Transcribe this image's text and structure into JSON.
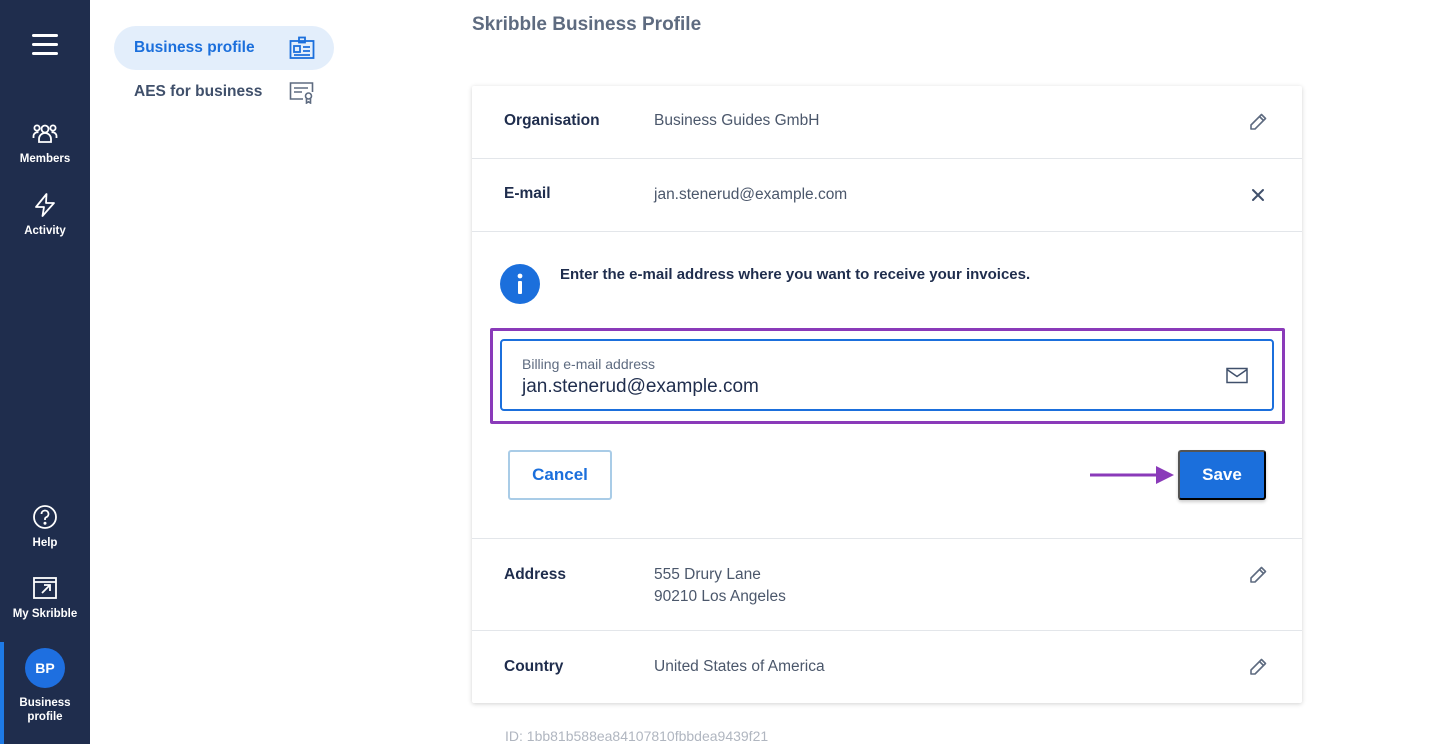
{
  "rail": {
    "items": [
      {
        "label": "Members",
        "icon": "members-icon"
      },
      {
        "label": "Activity",
        "icon": "activity-icon"
      },
      {
        "label": "Help",
        "icon": "help-icon"
      },
      {
        "label": "My Skribble",
        "icon": "external-link-icon"
      }
    ],
    "profile": {
      "initials": "BP",
      "label_line1": "Business",
      "label_line2": "profile"
    }
  },
  "subnav": {
    "items": [
      {
        "label": "Business profile",
        "icon": "id-card-icon",
        "active": true
      },
      {
        "label": "AES for business",
        "icon": "certificate-icon",
        "active": false
      }
    ]
  },
  "page": {
    "title": "Skribble Business Profile"
  },
  "card": {
    "organisation": {
      "key": "Organisation",
      "value": "Business Guides GmbH"
    },
    "email": {
      "key": "E-mail",
      "value": "jan.stenerud@example.com"
    },
    "info": "Enter the e-mail address where you want to receive your invoices.",
    "billing_field": {
      "label": "Billing e-mail address",
      "value": "jan.stenerud@example.com"
    },
    "cancel_label": "Cancel",
    "save_label": "Save",
    "address": {
      "key": "Address",
      "line1": "555 Drury Lane",
      "line2": "90210 Los Angeles"
    },
    "country": {
      "key": "Country",
      "value": "United States of America"
    }
  },
  "footer": {
    "id_text": "ID: 1bb81b588ea84107810fbbdea9439f21"
  },
  "colors": {
    "rail": "#1f2d4d",
    "accent": "#1b6fdc",
    "highlight": "#8a3ab9"
  }
}
